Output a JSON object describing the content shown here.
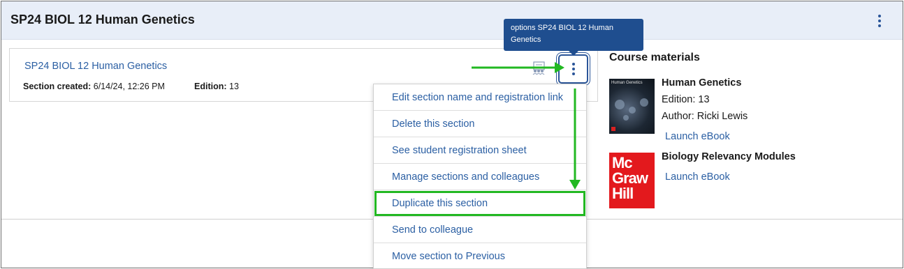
{
  "header": {
    "course_title": "SP24 BIOL 12 Human Genetics",
    "options_icon": "vertical-ellipsis-icon"
  },
  "section": {
    "name": "SP24 BIOL 12 Human Genetics",
    "created_label": "Section created:",
    "created_value": "6/14/24, 12:26 PM",
    "edition_label": "Edition:",
    "edition_value": "13",
    "registration_icon": "registration-sheet-icon",
    "options_icon": "vertical-ellipsis-icon"
  },
  "tooltip": {
    "text": "options SP24 BIOL 12 Human Genetics"
  },
  "menu": {
    "items": [
      {
        "label": "Edit section name and registration link"
      },
      {
        "label": "Delete this section"
      },
      {
        "label": "See student registration sheet"
      },
      {
        "label": "Manage sections and colleagues"
      },
      {
        "label": "Duplicate this section",
        "highlighted": true
      },
      {
        "label": "Send to colleague"
      },
      {
        "label": "Move section to Previous"
      }
    ]
  },
  "materials": {
    "title": "Course materials",
    "books": [
      {
        "title": "Human Genetics",
        "edition": "Edition: 13",
        "author": "Author: Ricki Lewis",
        "launch": "Launch eBook",
        "cover_text": "Human Genetics"
      },
      {
        "title": "Biology Relevancy Modules",
        "launch": "Launch eBook",
        "logo_text": "McGrawHill"
      }
    ]
  },
  "colors": {
    "header_bg": "#e8eef8",
    "link_blue": "#2b5fa3",
    "tooltip_bg": "#1f4e8f",
    "annotation_green": "#22b822",
    "brand_red": "#e3191d"
  }
}
